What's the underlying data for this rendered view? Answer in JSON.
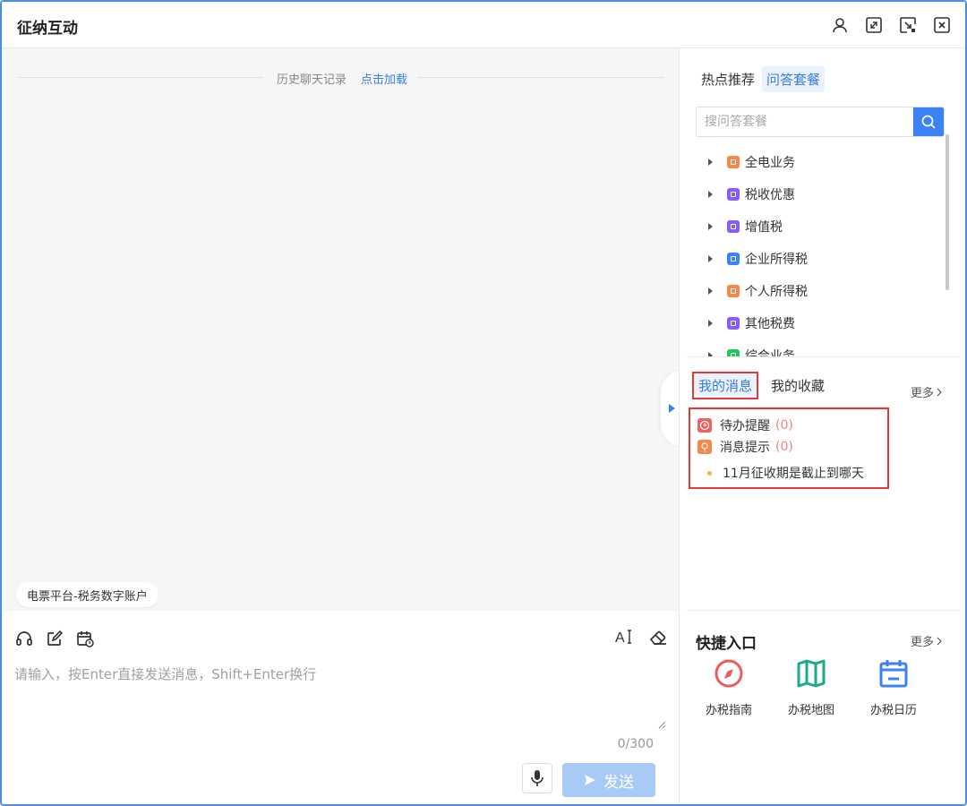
{
  "window": {
    "title": "征纳互动"
  },
  "chat": {
    "history_text": "历史聊天记录",
    "history_link": "点击加载",
    "platform_chip": "电票平台-税务数字账户"
  },
  "input": {
    "placeholder": "请输入，按Enter直接发送消息，Shift+Enter换行",
    "value": "",
    "counter": "0/300",
    "send_label": "发送",
    "font_tool_label": "A"
  },
  "right_panel": {
    "tabs": [
      "热点推荐",
      "问答套餐"
    ],
    "active_tab": "问答套餐",
    "search_placeholder": "搜问答套餐",
    "tree": [
      {
        "label": "全电业务",
        "color": "#f5894a"
      },
      {
        "label": "税收优惠",
        "color": "#8a5cf6"
      },
      {
        "label": "增值税",
        "color": "#8a5cf6"
      },
      {
        "label": "企业所得税",
        "color": "#3b82f6"
      },
      {
        "label": "个人所得税",
        "color": "#f5894a"
      },
      {
        "label": "其他税费",
        "color": "#8a5cf6"
      },
      {
        "label": "综合业务",
        "color": "#22c55e"
      }
    ],
    "message_tabs": [
      "我的消息",
      "我的收藏"
    ],
    "more_label": "更多",
    "messages": {
      "todo_label": "待办提醒",
      "todo_count": "(0)",
      "notice_label": "消息提示",
      "notice_count": "(0)",
      "item": "11月征收期是截止到哪天"
    },
    "quick": {
      "title": "快捷入口",
      "more_label": "更多",
      "items": [
        {
          "label": "办税指南",
          "icon": "compass-icon",
          "color": "#f05a5a"
        },
        {
          "label": "办税地图",
          "icon": "map-icon",
          "color": "#1aab8a"
        },
        {
          "label": "办税日历",
          "icon": "calendar-icon",
          "color": "#3b82f6"
        }
      ]
    }
  },
  "colors": {
    "accent": "#3b7ddd",
    "send_disabled": "#a9c9f7",
    "highlight_border": "#e53935"
  }
}
